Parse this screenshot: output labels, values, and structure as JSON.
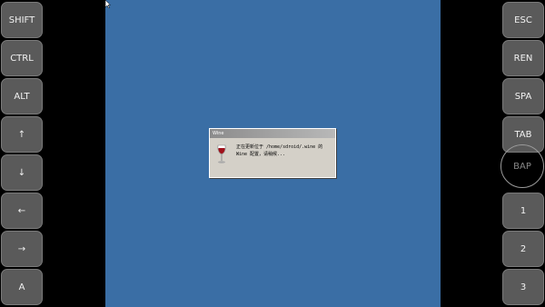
{
  "left_keys": [
    "SHIFT",
    "CTRL",
    "ALT",
    "↑",
    "↓",
    "←",
    "→",
    "A"
  ],
  "right_keys": [
    "ESC",
    "REN",
    "SPA",
    "TAB",
    "BAP",
    "1",
    "2",
    "3"
  ],
  "dialog": {
    "title": "Wine",
    "message_line1": "正在更新位于 /home/sdroid/.wine 的",
    "message_line2": "Wine 配置，请稍候..."
  },
  "colors": {
    "desktop": "#3a6ea5",
    "key_bg": "#5a5a5a",
    "dialog_bg": "#d4d0c8"
  }
}
